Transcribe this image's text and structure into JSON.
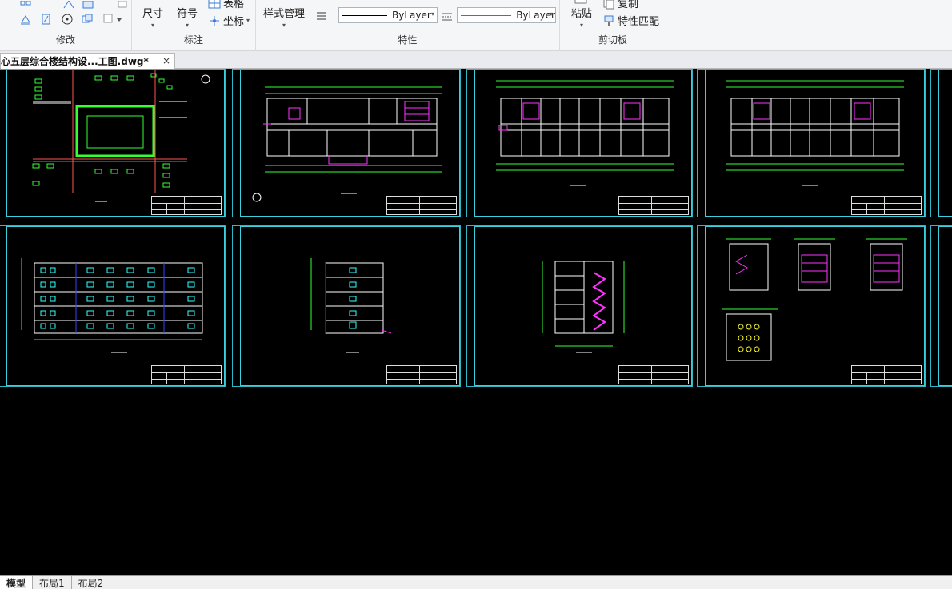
{
  "ribbon": {
    "panels": {
      "modify": {
        "title": "修改"
      },
      "annotation": {
        "title": "标注",
        "dimension_label": "尺寸",
        "symbol_label": "符号",
        "table_label": "表格",
        "coordinate_label": "坐标"
      },
      "properties": {
        "title": "特性",
        "style_manager_label": "样式管理",
        "color_value": "ByLayer",
        "linetype_value": "ByLayer"
      },
      "clipboard": {
        "title": "剪切板",
        "paste_label": "粘贴",
        "copy_label": "复制",
        "match_props_label": "特性匹配"
      }
    }
  },
  "document_tab": {
    "title": "心五层综合楼结构设...工图.dwg*",
    "close_glyph": "×"
  },
  "layout_tabs": [
    {
      "label": "模型",
      "active": true
    },
    {
      "label": "布局1",
      "active": false
    },
    {
      "label": "布局2",
      "active": false
    }
  ],
  "colors": {
    "canvas": "#000000",
    "frame": "#3ad0e0",
    "drawing_green": "#33ff33",
    "drawing_magenta": "#ff33ff",
    "drawing_blue": "#3333ff"
  },
  "sheets": [
    {
      "name": "site-plan"
    },
    {
      "name": "floor-plan-1"
    },
    {
      "name": "floor-plan-2"
    },
    {
      "name": "floor-plan-3"
    },
    {
      "name": "front-elevation"
    },
    {
      "name": "side-elevation"
    },
    {
      "name": "stair-section"
    },
    {
      "name": "details"
    }
  ]
}
